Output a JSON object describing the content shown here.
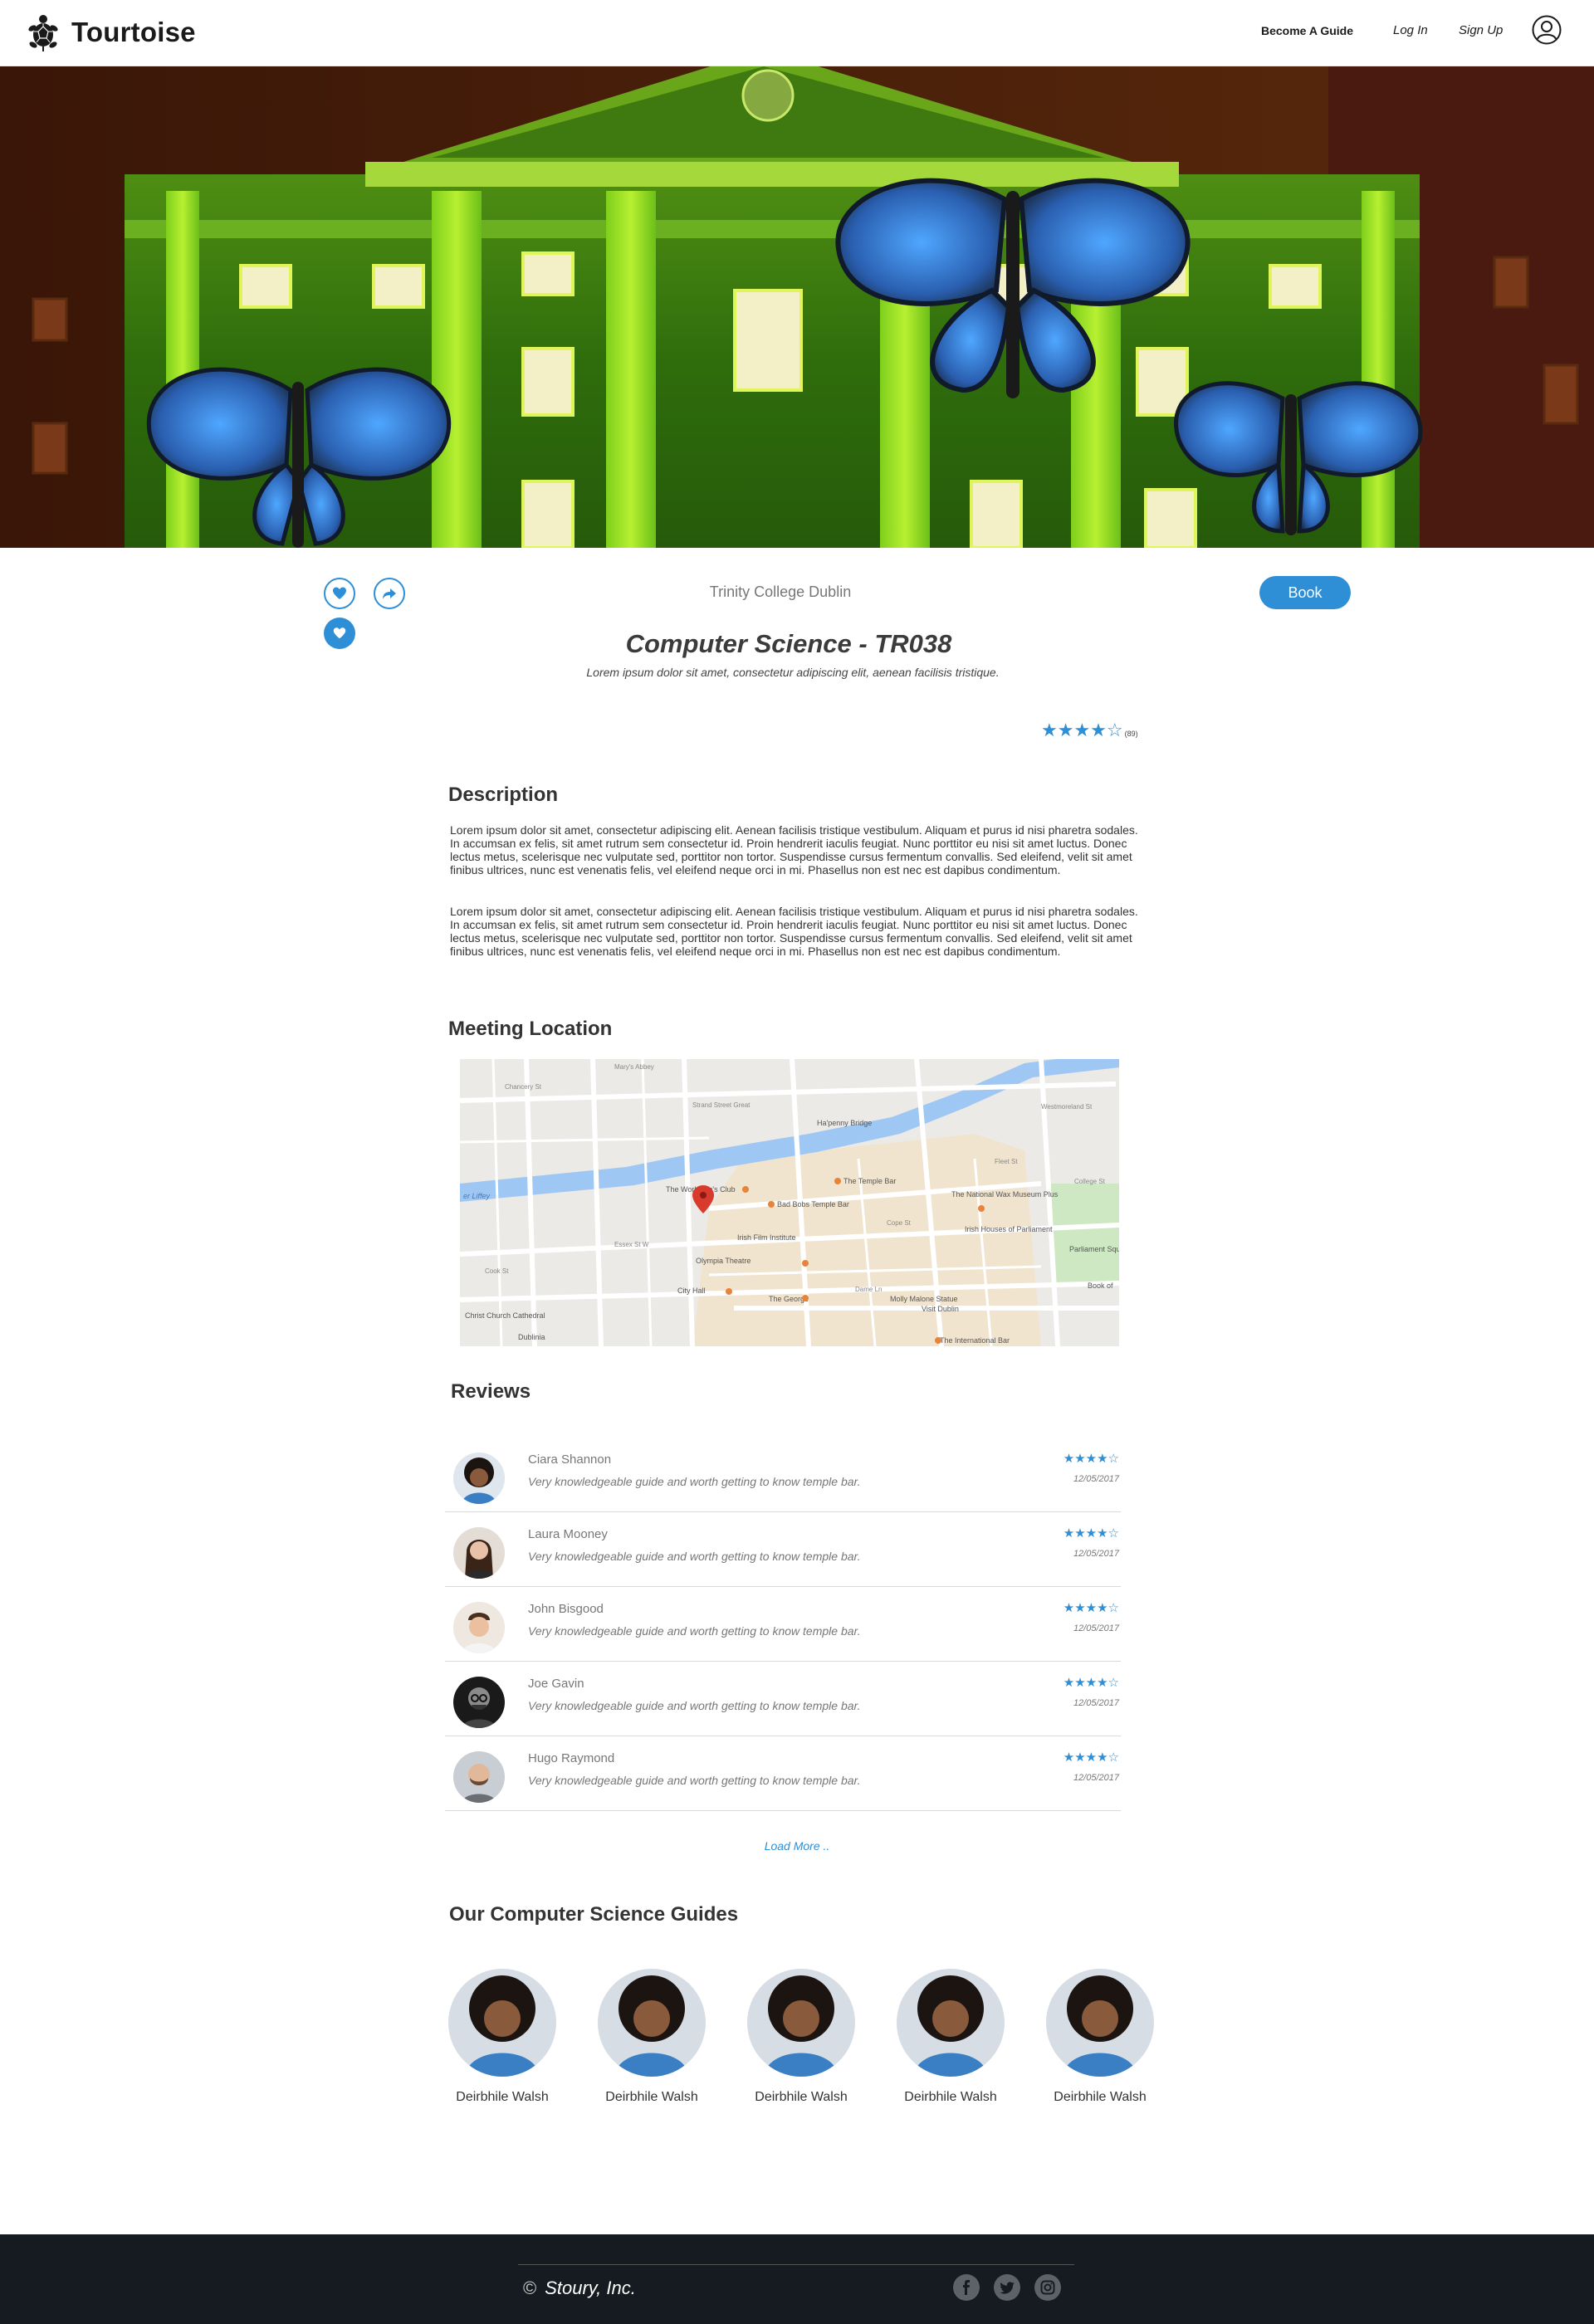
{
  "header": {
    "brand": "Tourtoise",
    "nav": {
      "become_guide": "Become A Guide",
      "login": "Log In",
      "signup": "Sign Up"
    },
    "icons": {
      "logo": "turtle-icon",
      "profile": "user-icon"
    }
  },
  "tour": {
    "location": "Trinity College Dublin",
    "book_label": "Book",
    "title": "Computer Science - TR038",
    "subtitle": "Lorem ipsum dolor sit amet, consectetur adipiscing elit, aenean facilisis tristique.",
    "rating": {
      "stars": "★★★★☆",
      "value": 4,
      "max": 5,
      "count": "(89)"
    },
    "actions": {
      "like": "heart-icon",
      "share": "share-icon",
      "favorite": "heart-icon"
    }
  },
  "description": {
    "heading": "Description",
    "paragraphs": [
      "Lorem ipsum dolor sit amet, consectetur adipiscing elit. Aenean facilisis tristique vestibulum. Aliquam et purus id nisi pharetra sodales. In accumsan ex felis, sit amet rutrum sem consectetur id. Proin hendrerit iaculis feugiat. Nunc porttitor eu nisi sit amet luctus. Donec lectus metus, scelerisque nec vulputate sed, porttitor non tortor. Suspendisse cursus fermentum convallis. Sed eleifend, velit sit amet finibus ultrices, nunc est venenatis felis, vel eleifend neque orci in mi. Phasellus non est nec est dapibus condimentum.",
      "Lorem ipsum dolor sit amet, consectetur adipiscing elit. Aenean facilisis tristique vestibulum. Aliquam et purus id nisi pharetra sodales. In accumsan ex felis, sit amet rutrum sem consectetur id. Proin hendrerit iaculis feugiat. Nunc porttitor eu nisi sit amet luctus. Donec lectus metus, scelerisque nec vulputate sed, porttitor non tortor. Suspendisse cursus fermentum convallis. Sed eleifend, velit sit amet finibus ultrices, nunc est venenatis felis, vel eleifend neque orci in mi. Phasellus non est nec est dapibus condimentum."
    ]
  },
  "meeting": {
    "heading": "Meeting Location",
    "map_labels": {
      "liffey": "er Liffey",
      "ha_penny": "Ha'penny Bridge",
      "workmans": "The Workman's Club",
      "temple_bar": "The Temple Bar",
      "bad_bobs": "Bad Bobs Temple Bar",
      "irish_film": "Irish Film Institute",
      "olympia": "Olympia Theatre",
      "city_hall": "City Hall",
      "the_george": "The George",
      "molly": "Molly Malone Statue",
      "visit_dublin": "Visit Dublin",
      "wax": "The National Wax Museum Plus",
      "irish_houses": "Irish Houses of Parliament",
      "parliament_sq": "Parliament Square",
      "christ_church": "Christ Church Cathedral",
      "dublinia": "Dublinia",
      "intl_bar": "The International Bar",
      "book_of": "Book of",
      "marys_abbey": "Mary's Abbey",
      "chancery": "Chancery St",
      "strand": "Strand Street Great",
      "fleet": "Fleet St",
      "cope": "Cope St",
      "essex": "Essex St W",
      "dame": "Dame Ln",
      "cook": "Cook St",
      "college": "College St",
      "westmoreland": "Westmoreland St"
    }
  },
  "reviews": {
    "heading": "Reviews",
    "items": [
      {
        "name": "Ciara Shannon",
        "text": "Very knowledgeable guide and worth getting to know temple bar.",
        "stars": "★★★★☆",
        "rating": 4,
        "date": "12/05/2017"
      },
      {
        "name": "Laura Mooney",
        "text": "Very knowledgeable guide and worth getting to know temple bar.",
        "stars": "★★★★☆",
        "rating": 4,
        "date": "12/05/2017"
      },
      {
        "name": "John Bisgood",
        "text": "Very knowledgeable guide and worth getting to know temple bar.",
        "stars": "★★★★☆",
        "rating": 4,
        "date": "12/05/2017"
      },
      {
        "name": "Joe Gavin",
        "text": "Very knowledgeable guide and worth getting to know temple bar.",
        "stars": "★★★★☆",
        "rating": 4,
        "date": "12/05/2017"
      },
      {
        "name": "Hugo Raymond",
        "text": "Very knowledgeable guide and worth getting to know temple bar.",
        "stars": "★★★★☆",
        "rating": 4,
        "date": "12/05/2017"
      }
    ],
    "load_more": "Load More .."
  },
  "guides": {
    "heading": "Our Computer Science Guides",
    "items": [
      {
        "name": "Deirbhile Walsh"
      },
      {
        "name": "Deirbhile Walsh"
      },
      {
        "name": "Deirbhile Walsh"
      },
      {
        "name": "Deirbhile Walsh"
      },
      {
        "name": "Deirbhile Walsh"
      }
    ]
  },
  "footer": {
    "copy_symbol": "©",
    "company": "Stoury, Inc.",
    "social": [
      "facebook-icon",
      "twitter-icon",
      "instagram-icon"
    ]
  },
  "colors": {
    "accent": "#2e8fd6",
    "footer_bg": "#161b21",
    "text": "#333333"
  }
}
